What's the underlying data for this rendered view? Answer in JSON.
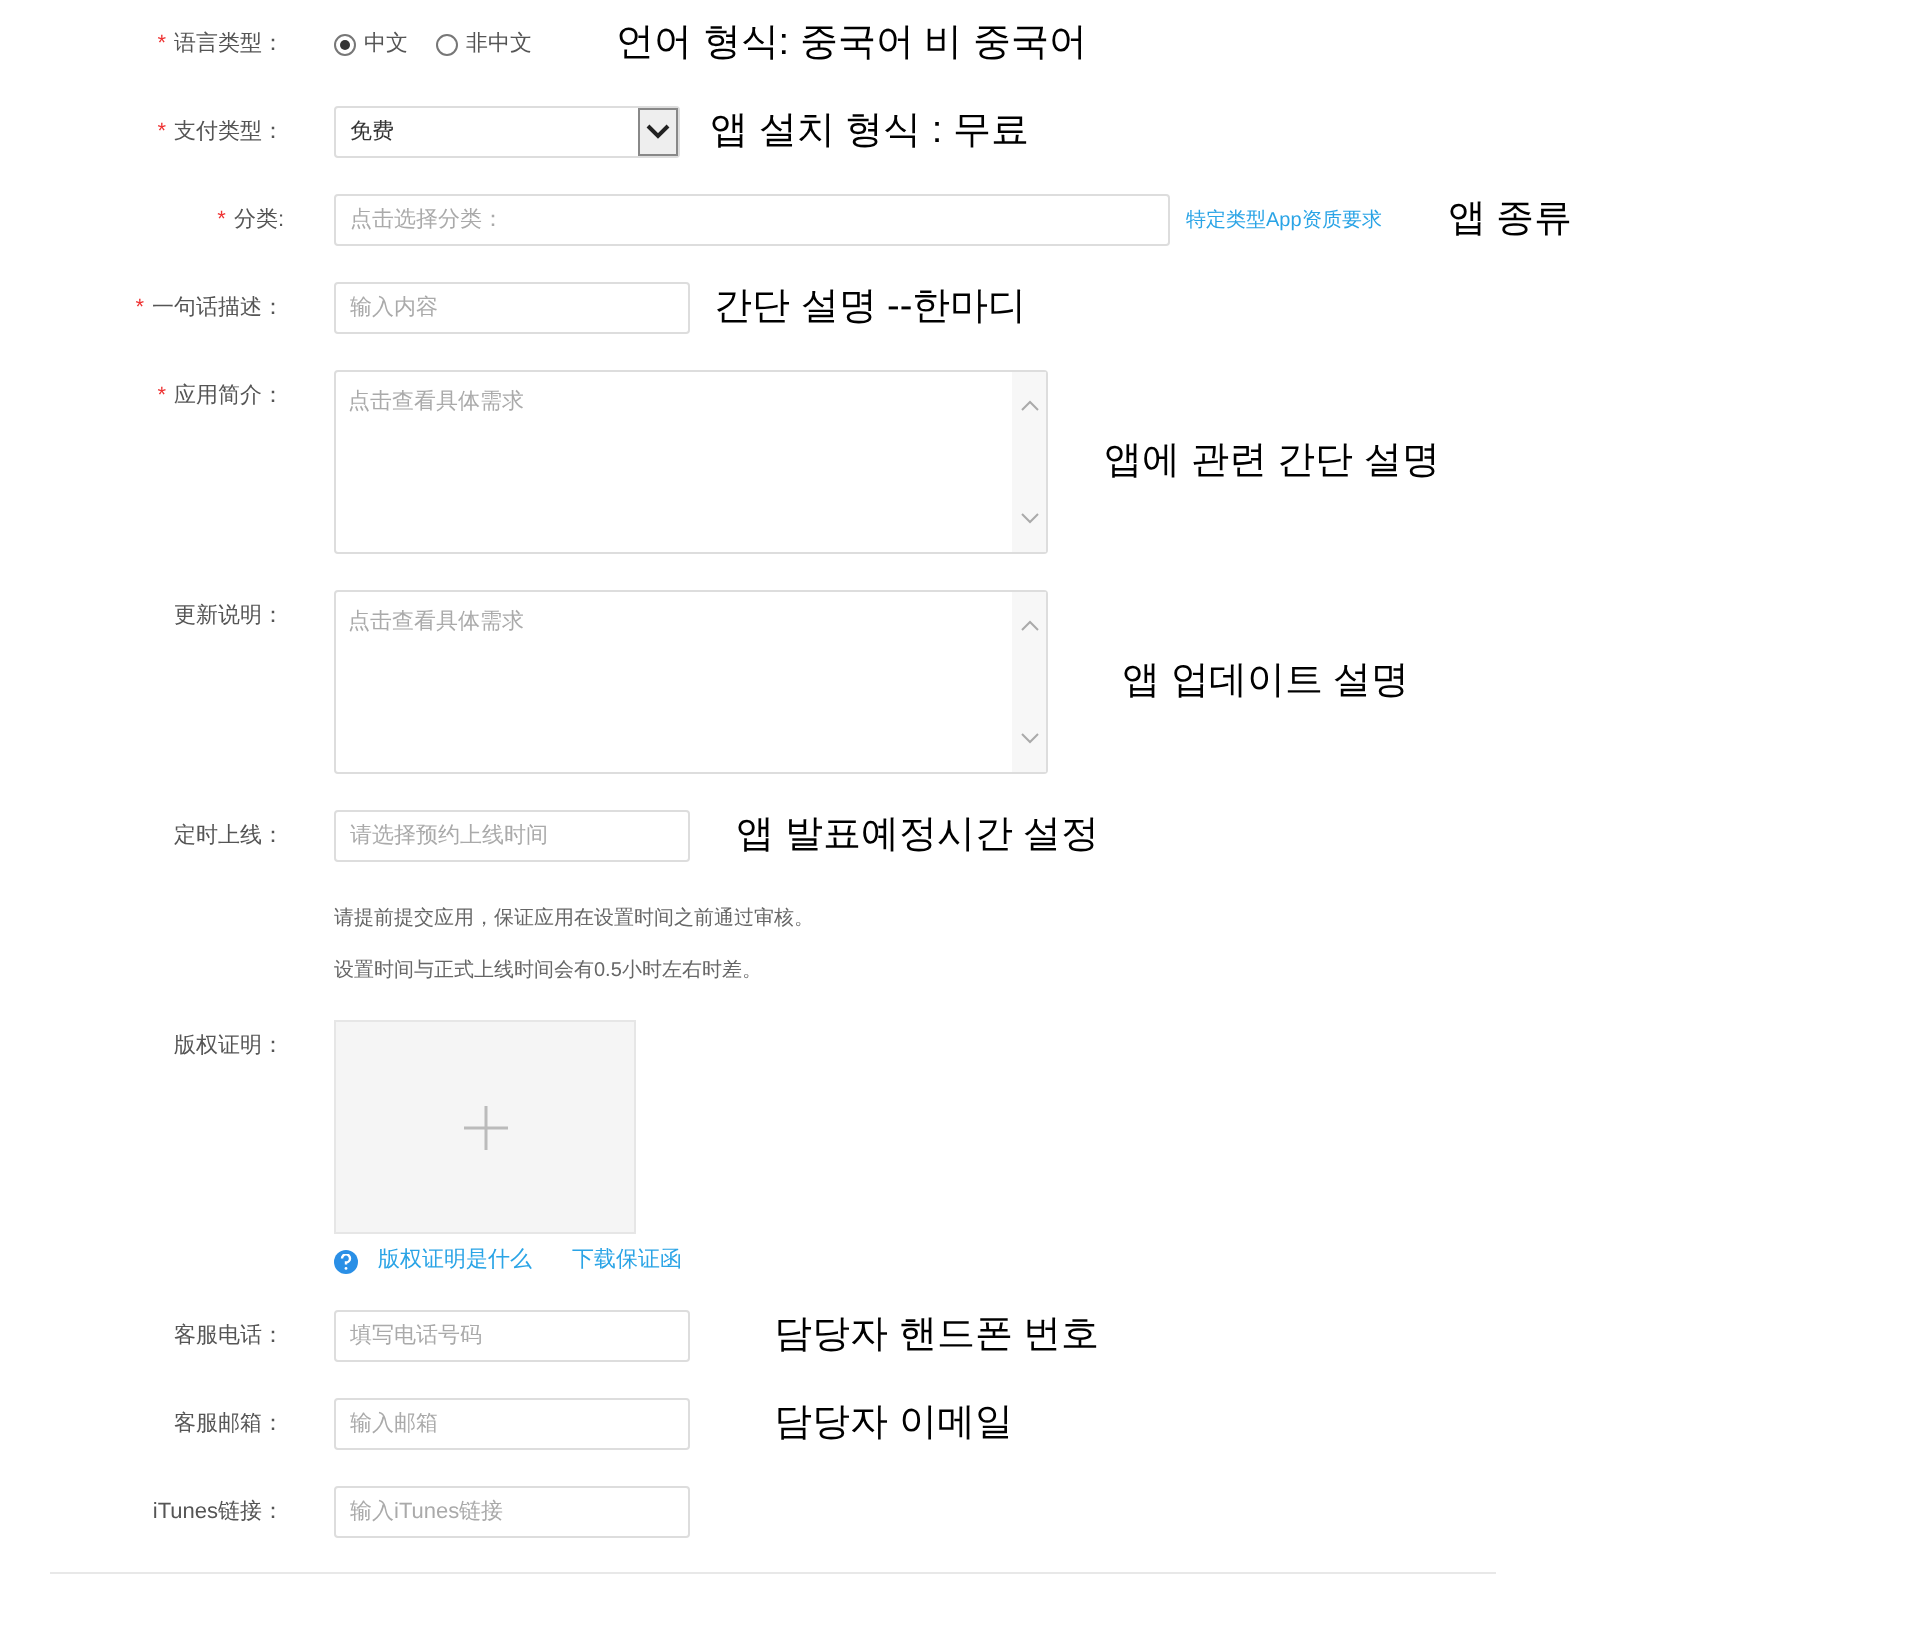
{
  "fields": [
    {
      "kind": "radio",
      "label": "语言类型：",
      "marker": "*",
      "options": [
        {
          "label": "中文",
          "selected": true
        },
        {
          "label": "非中文",
          "selected": false
        }
      ],
      "annotation": "언어 형식:  중국어     비 중국어"
    },
    {
      "kind": "select",
      "label": "支付类型：",
      "marker": "*",
      "value": "免费",
      "annotation": "앱 설치 형식 :  무료"
    },
    {
      "kind": "input",
      "label": "分类:",
      "marker": "*",
      "placeholder": "点击选择分类：",
      "link": "特定类型App资质要求",
      "annotation": "앱 종류"
    },
    {
      "kind": "input",
      "label": "一句话描述：",
      "marker": "*",
      "placeholder": "输入内容",
      "annotation": "간단 설명 --한마디"
    },
    {
      "kind": "textarea",
      "label": "应用简介：",
      "marker": "*",
      "placeholder": "点击查看具体需求",
      "annotation": "앱에 관련 간단 설명"
    },
    {
      "kind": "textarea",
      "label": "更新说明：",
      "placeholder": "点击查看具体需求",
      "annotation": "앱 업데이트  설명"
    },
    {
      "kind": "input",
      "label": "定时上线：",
      "placeholder": "请选择预约上线时间",
      "annotation": "앱  발표예정시간 설정",
      "hints": [
        "请提前提交应用，保证应用在设置时间之前通过审核。",
        "设置时间与正式上线时间会有0.5小时左右时差。"
      ]
    },
    {
      "kind": "upload",
      "label": "版权证明：",
      "links": [
        {
          "kind": "help",
          "text": "版权证明是什么"
        },
        {
          "kind": "plain",
          "text": "下载保证函"
        }
      ]
    },
    {
      "kind": "input",
      "label": "客服电话：",
      "placeholder": "填写电话号码",
      "annotation": "담당자 핸드폰 번호"
    },
    {
      "kind": "input",
      "label": "客服邮箱：",
      "placeholder": "输入邮箱",
      "annotation": "담당자 이메일"
    },
    {
      "kind": "input",
      "label": "iTunes链接：",
      "placeholder": "输入iTunes链接"
    }
  ]
}
